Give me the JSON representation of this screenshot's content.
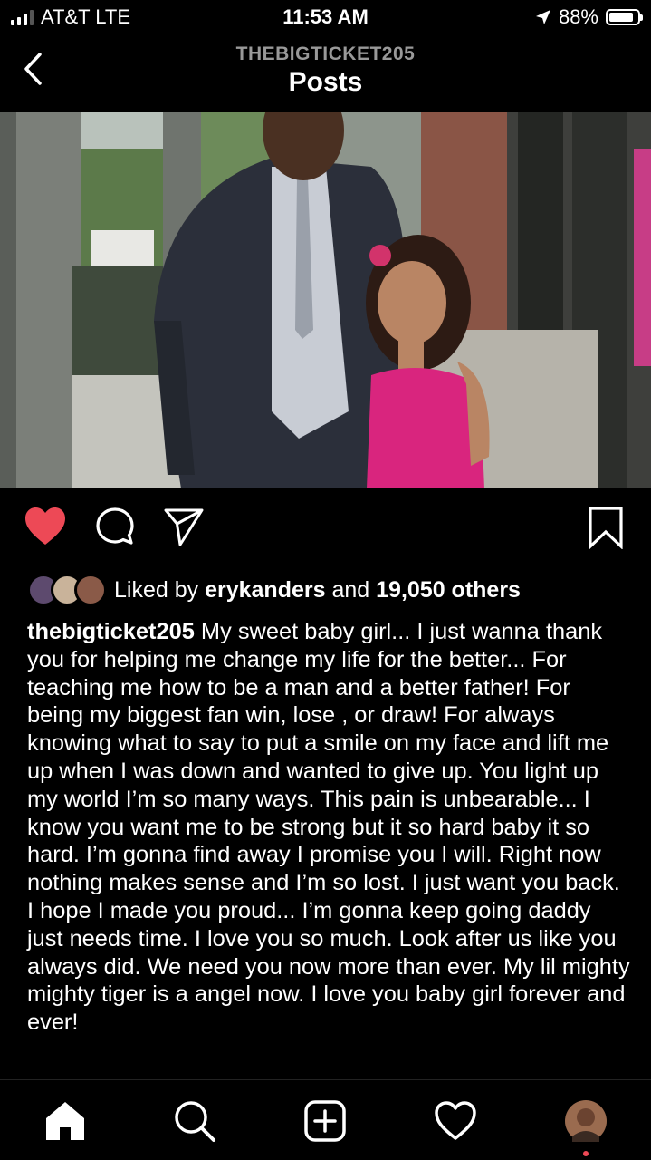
{
  "status_bar": {
    "carrier": "AT&T LTE",
    "time": "11:53 AM",
    "battery_percent_text": "88%",
    "battery_level": 0.88
  },
  "header": {
    "username": "THEBIGTICKET205",
    "title": "Posts"
  },
  "post": {
    "image_icon": "photo",
    "likes": {
      "prefix": "Liked by",
      "user": "erykanders",
      "middle": "and",
      "others": "19,050 others"
    },
    "caption": {
      "username": "thebigticket205",
      "text": "My sweet baby girl... I just wanna thank you for helping me change my life for the better... For teaching me how to be a man and a better father! For being my biggest fan win, lose , or draw! For always knowing what to say to put a smile on my face and lift me up when I was down and wanted to give up. You light up my world I’m so many ways. This pain is unbearable... I know you want me to be strong but it so hard baby it so hard. I’m gonna find away I promise you I will. Right now nothing makes sense and I’m so lost. I just want you back. I hope I made you proud... I’m gonna keep going daddy just needs time. I love you so much. Look after us like you always did. We need you now more than ever. My lil mighty mighty tiger is a angel now. I love you baby girl forever and ever!"
    }
  },
  "colors": {
    "like_red": "#ed4956",
    "notification_dot": "#ed4956"
  },
  "icons": [
    "back-chevron",
    "heart-filled",
    "comment",
    "share",
    "bookmark",
    "home",
    "search",
    "add",
    "heart-outline",
    "profile-avatar"
  ]
}
